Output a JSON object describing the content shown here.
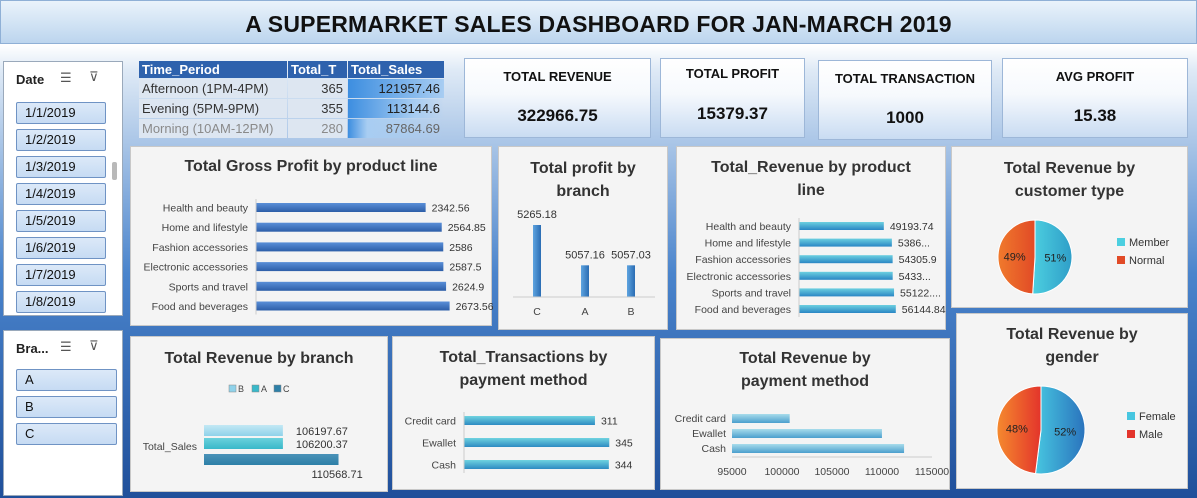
{
  "title": "A SUPERMARKET SALES DASHBOARD FOR JAN-MARCH 2019",
  "colors": {
    "bar": "#3a86c8",
    "member": "#4fc8d2",
    "normal": "#e8612a",
    "female": "#3ec1d3",
    "male": "#e8612a"
  },
  "date_slicer": {
    "header": "Date",
    "items": [
      "1/1/2019",
      "1/2/2019",
      "1/3/2019",
      "1/4/2019",
      "1/5/2019",
      "1/6/2019",
      "1/7/2019",
      "1/8/2019"
    ]
  },
  "branch_slicer": {
    "header": "Bra...",
    "items": [
      "A",
      "B",
      "C"
    ]
  },
  "pivot": {
    "headers": [
      "Time_Period",
      "Total_T",
      "Total_Sales"
    ],
    "rows": [
      {
        "period": "Afternoon (1PM-4PM)",
        "transactions": "365",
        "sales": "121957.46"
      },
      {
        "period": "Evening (5PM-9PM)",
        "transactions": "355",
        "sales": "113144.6"
      },
      {
        "period": "Morning (10AM-12PM)",
        "transactions": "280",
        "sales": "87864.69"
      }
    ]
  },
  "kpis": [
    {
      "label": "TOTAL REVENUE",
      "value": "322966.75"
    },
    {
      "label": "TOTAL PROFIT",
      "value": "15379.37"
    },
    {
      "label": "TOTAL TRANSACTION",
      "value": "1000"
    },
    {
      "label": "AVG PROFIT",
      "value": "15.38"
    }
  ],
  "chart_data": [
    {
      "id": "gross_profit",
      "type": "bar",
      "orientation": "horizontal",
      "title": "Total Gross Profit by product line",
      "categories": [
        "Health and beauty",
        "Home and lifestyle",
        "Fashion accessories",
        "Electronic accessories",
        "Sports and travel",
        "Food and beverages"
      ],
      "values": [
        2342.56,
        2564.85,
        2586,
        2587.5,
        2624.9,
        2673.56
      ],
      "labels": [
        "2342.56",
        "2564.85",
        "2586",
        "2587.5",
        "2624.9",
        "2673.56"
      ],
      "xlim": [
        0,
        2900
      ]
    },
    {
      "id": "profit_branch",
      "type": "bar",
      "orientation": "vertical",
      "title": "Total  profit by branch",
      "categories": [
        "C",
        "A",
        "B"
      ],
      "values": [
        5265.18,
        5057.16,
        5057.03
      ],
      "labels": [
        "5265.18",
        "5057.16",
        "5057.03"
      ],
      "ylim": [
        0,
        5600
      ]
    },
    {
      "id": "revenue_product",
      "type": "bar",
      "orientation": "horizontal",
      "title": "Total_Revenue by product line",
      "categories": [
        "Health and beauty",
        "Home and lifestyle",
        "Fashion accessories",
        "Electronic accessories",
        "Sports and travel",
        "Food and beverages"
      ],
      "values": [
        49193.74,
        53861.9,
        54305.9,
        54337.5,
        55122.8,
        56144.84
      ],
      "labels": [
        "49193.74",
        "5386...",
        "54305.9",
        "5433...",
        "55122....",
        "56144.84"
      ],
      "xlim": [
        0,
        58000
      ]
    },
    {
      "id": "customer_type",
      "type": "pie",
      "title": "Total Revenue by customer type",
      "categories": [
        "Member",
        "Normal"
      ],
      "values": [
        51,
        49
      ],
      "labels": [
        "51%",
        "49%"
      ]
    },
    {
      "id": "revenue_branch",
      "type": "bar",
      "orientation": "horizontal",
      "title": "Total Revenue by branch",
      "x": [
        "Total_Sales"
      ],
      "legend": [
        "B",
        "A",
        "C"
      ],
      "series": [
        {
          "name": "B",
          "values": [
            106197.67
          ],
          "label": "106197.67"
        },
        {
          "name": "A",
          "values": [
            106200.37
          ],
          "label": "106200.37"
        },
        {
          "name": "C",
          "values": [
            110568.71
          ],
          "label": "110568.71"
        }
      ]
    },
    {
      "id": "transactions_payment",
      "type": "bar",
      "orientation": "horizontal",
      "title": "Total_Transactions by payment method",
      "categories": [
        "Credit card",
        "Ewallet",
        "Cash"
      ],
      "values": [
        311,
        345,
        344
      ],
      "labels": [
        "311",
        "345",
        "344"
      ],
      "xlim": [
        0,
        380
      ]
    },
    {
      "id": "revenue_payment",
      "type": "bar",
      "orientation": "horizontal",
      "title": "Total Revenue by payment method",
      "categories": [
        "Credit card",
        "Ewallet",
        "Cash"
      ],
      "values": [
        100767.07,
        109993.11,
        112206.57
      ],
      "xlim": [
        95000,
        115000
      ],
      "ticks": [
        "95000",
        "100000",
        "105000",
        "110000",
        "115000"
      ]
    },
    {
      "id": "gender",
      "type": "pie",
      "title": "Total Revenue by gender",
      "categories": [
        "Female",
        "Male"
      ],
      "values": [
        52,
        48
      ],
      "labels": [
        "52%",
        "48%"
      ]
    }
  ]
}
